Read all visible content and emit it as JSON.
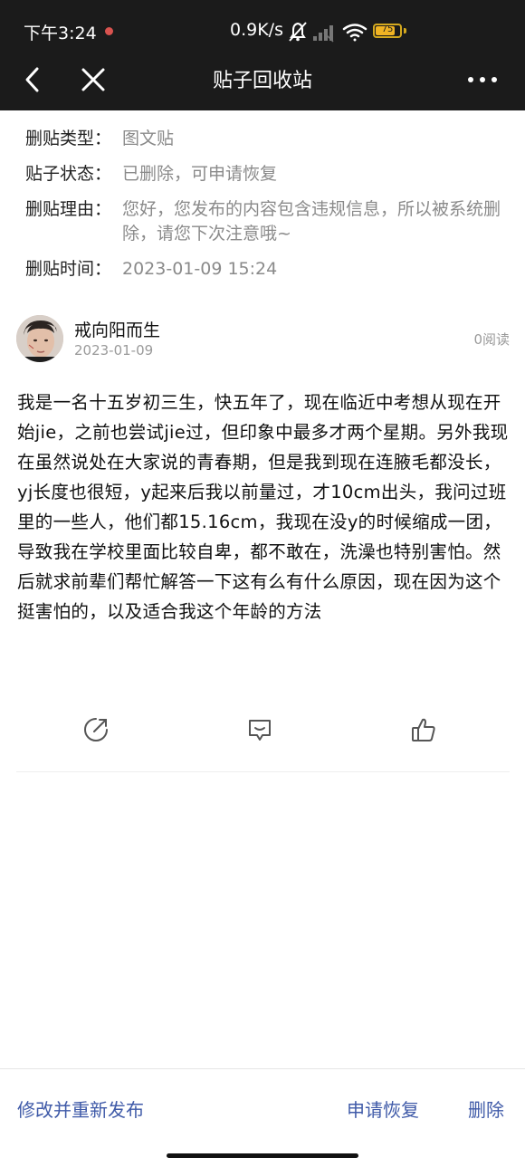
{
  "status_bar": {
    "time": "下午3:24",
    "network_speed": "0.9K/s",
    "battery_level": "75",
    "icons": [
      "mute-bell-icon",
      "signal-icon",
      "wifi-icon",
      "battery-icon"
    ]
  },
  "nav": {
    "title": "贴子回收站",
    "icons": [
      "back-icon",
      "close-icon",
      "more-icon"
    ]
  },
  "info": {
    "type_label": "删贴类型：",
    "type_value": "图文贴",
    "status_label": "贴子状态：",
    "status_value": "已删除，可申请恢复",
    "reason_label": "删贴理由：",
    "reason_value": "您好，您发布的内容包含违规信息，所以被系统删除，请您下次注意哦~",
    "time_label": "删贴时间：",
    "time_value": "2023-01-09 15:24"
  },
  "author": {
    "name": "戒向阳而生",
    "date": "2023-01-09",
    "reads": "0阅读"
  },
  "post": {
    "content": "我是一名十五岁初三生，快五年了，现在临近中考想从现在开始jie，之前也尝试jie过，但印象中最多才两个星期。另外我现在虽然说处在大家说的青春期，但是我到现在连腋毛都没长，yj长度也很短，y起来后我以前量过，才10cm出头，我问过班里的一些人，他们都15.16cm，我现在没y的时候缩成一团，导致我在学校里面比较自卑，都不敢在，洗澡也特别害怕。然后就求前辈们帮忙解答一下这有么有什么原因，现在因为这个挺害怕的，以及适合我这个年龄的方法"
  },
  "actions": {
    "icons": [
      "edit-icon",
      "comment-icon",
      "like-icon"
    ]
  },
  "footer": {
    "edit_repost": "修改并重新发布",
    "request_restore": "申请恢复",
    "delete": "删除"
  },
  "colors": {
    "header_bg": "#1b1b1b",
    "link": "#3f5aa8",
    "muted_text": "#8a8a8a"
  }
}
